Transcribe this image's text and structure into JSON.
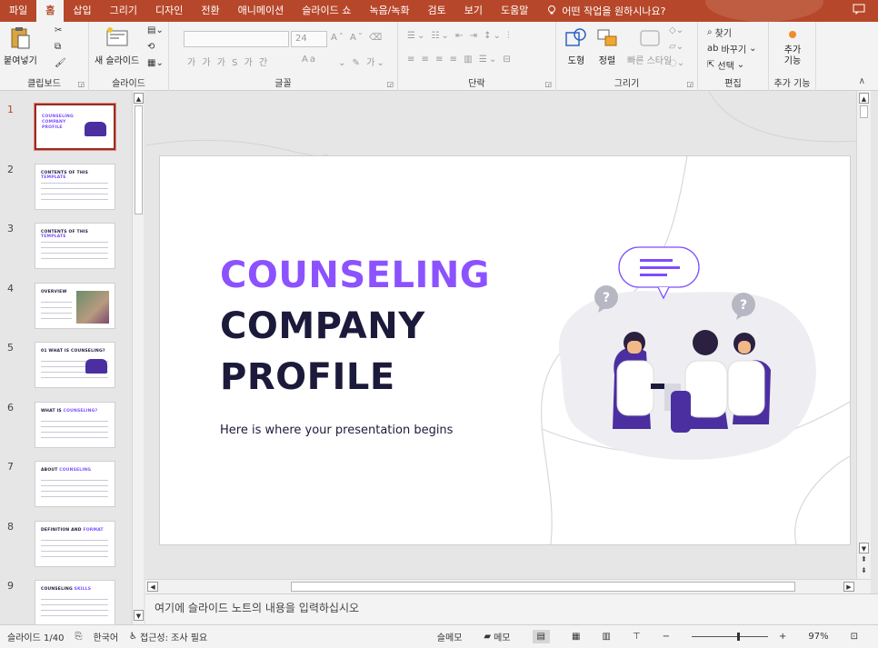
{
  "tabs": [
    "파일",
    "홈",
    "삽입",
    "그리기",
    "디자인",
    "전환",
    "애니메이션",
    "슬라이드 쇼",
    "녹음/녹화",
    "검토",
    "보기",
    "도움말"
  ],
  "active_tab": 1,
  "tell_me": "어떤 작업을 원하시나요?",
  "ribbon": {
    "clipboard": {
      "paste": "붙여넣기",
      "label": "클립보드"
    },
    "slides": {
      "new_slide": "새 슬라이드",
      "label": "슬라이드"
    },
    "font": {
      "size": "24",
      "label": "글꼴",
      "aa_label": "Aa"
    },
    "paragraph": {
      "label": "단락"
    },
    "drawing": {
      "shapes": "도형",
      "arrange": "정렬",
      "quick_styles": "빠른 스타일",
      "label": "그리기"
    },
    "editing": {
      "find": "찾기",
      "replace": "바꾸기",
      "select": "선택",
      "label": "편집"
    },
    "addins": {
      "button": "추가 기능",
      "label": "추가 기능"
    }
  },
  "thumbnails": [
    {
      "num": "1",
      "title": "COUNSELING COMPANY PROFILE",
      "accent": ""
    },
    {
      "num": "2",
      "title": "CONTENTS OF THIS ",
      "accent": "TEMPLATE"
    },
    {
      "num": "3",
      "title": "CONTENTS OF THIS ",
      "accent": "TEMPLATE"
    },
    {
      "num": "4",
      "title": "OVERVIEW",
      "accent": ""
    },
    {
      "num": "5",
      "title": "01 WHAT IS COUNSELING?",
      "accent": ""
    },
    {
      "num": "6",
      "title": "WHAT IS ",
      "accent": "COUNSELING?"
    },
    {
      "num": "7",
      "title": "ABOUT ",
      "accent": "COUNSELING"
    },
    {
      "num": "8",
      "title": "DEFINITION AND ",
      "accent": "FORMAT"
    },
    {
      "num": "9",
      "title": "COUNSELING ",
      "accent": "SKILLS"
    }
  ],
  "slide": {
    "title_line1": "COUNSELING",
    "title_line2": "COMPANY",
    "title_line3": "PROFILE",
    "subtitle": "Here is where your presentation begins",
    "question_mark": "?",
    "accent_color": "#8c52ff",
    "dark_color": "#1c1a3b"
  },
  "notes_placeholder": "여기에 슬라이드 노트의 내용을 입력하십시오",
  "status": {
    "slide_info": "슬라이드 1/40",
    "language": "한국어",
    "accessibility": "접근성: 조사 필요",
    "notes_btn": "슬메모",
    "comments_btn": "메모",
    "zoom": "97%",
    "zoom_fraction": 0.6
  }
}
